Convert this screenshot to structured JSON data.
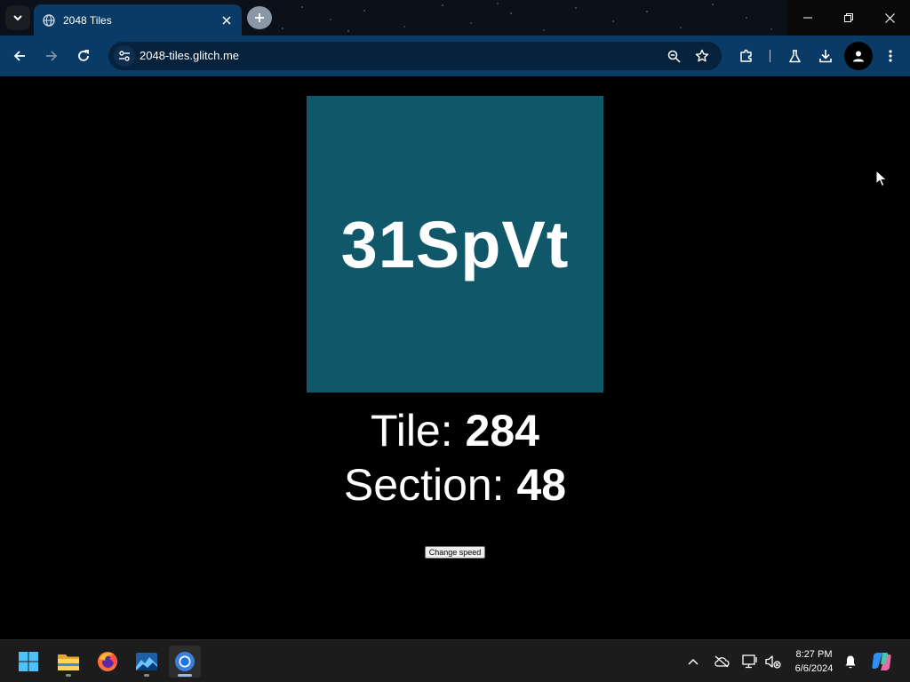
{
  "browser": {
    "tab_title": "2048 Tiles",
    "url": "2048-tiles.glitch.me",
    "accent_color": "#0a3a66"
  },
  "page": {
    "tile_label": "31SpVt",
    "tile_color": "#0f5769",
    "tile_prefix": "Tile: ",
    "tile_number": "284",
    "section_prefix": "Section: ",
    "section_number": "48",
    "speed_button_label": "Change speed"
  },
  "taskbar": {
    "apps": [
      "start-icon",
      "file-explorer-icon",
      "firefox-icon",
      "photos-icon",
      "chrome-icon"
    ],
    "time": "8:27 PM",
    "date": "6/6/2024"
  }
}
